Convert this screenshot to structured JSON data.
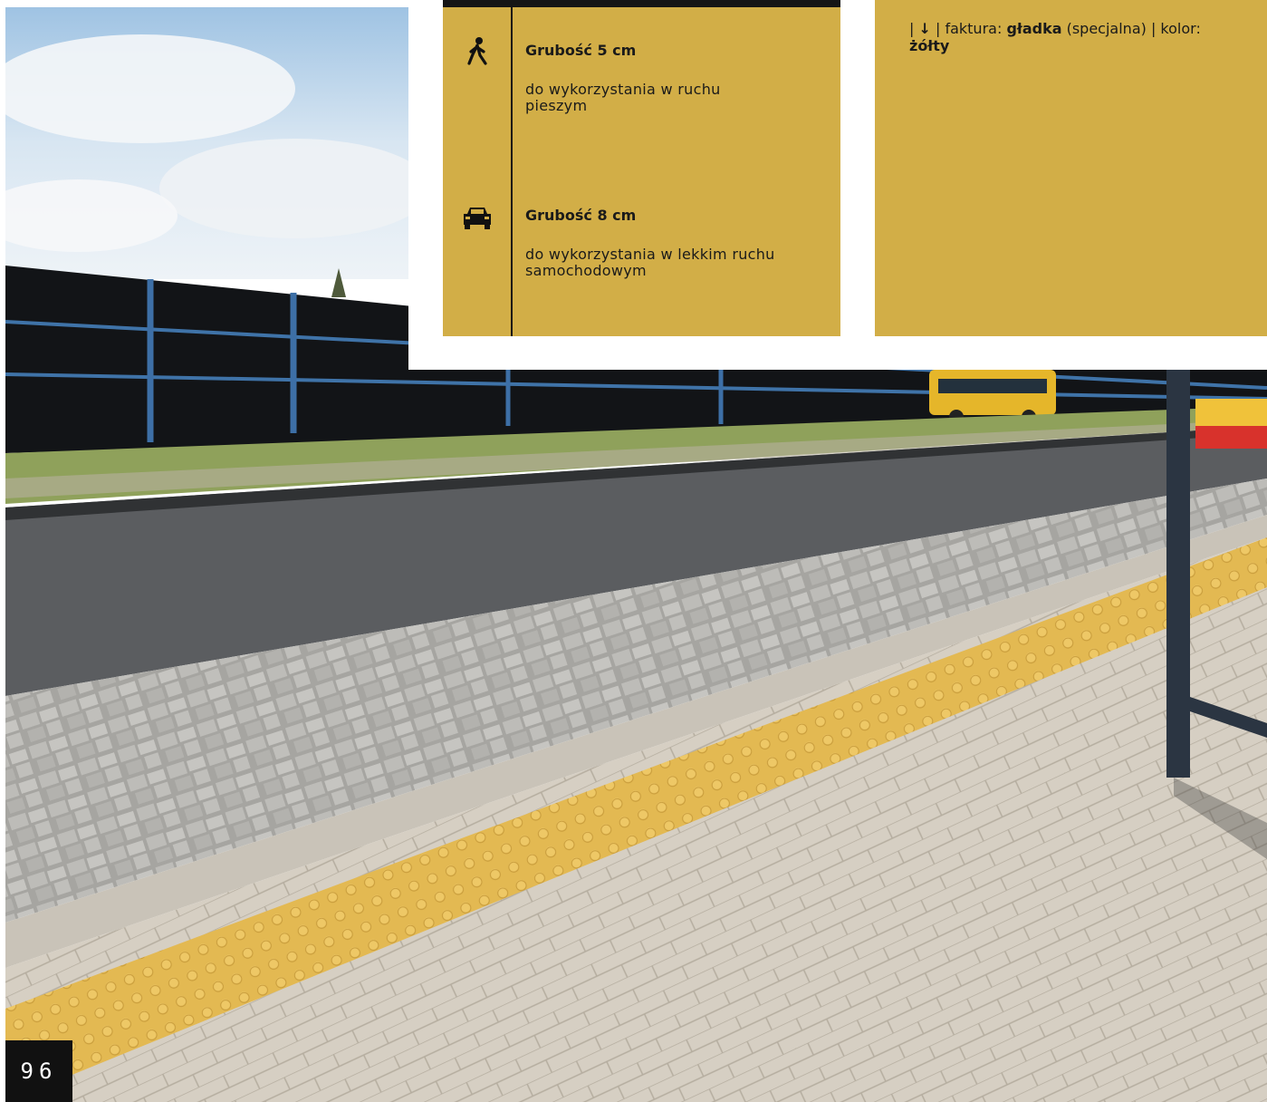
{
  "info_table": {
    "rows": [
      {
        "icon": "pedestrian-icon",
        "title": "Grubość 5 cm",
        "description": "do wykorzystania w ruchu pieszym"
      },
      {
        "icon": "car-icon",
        "title": "Grubość 8 cm",
        "description": "do wykorzystania w lekkim ruchu samochodowym"
      }
    ]
  },
  "spec": {
    "pipe1": "| ",
    "arrow": "↓",
    "pipe2": " | ",
    "texture_label": "faktura: ",
    "texture_value": "gładka",
    "texture_note": " (specjalna) | ",
    "color_label": "kolor: ",
    "color_value": "żółty"
  },
  "page_number": "96",
  "colors": {
    "gold": "#d2ae47",
    "tactile_yellow": "#e5bd55",
    "dark": "#151515"
  }
}
